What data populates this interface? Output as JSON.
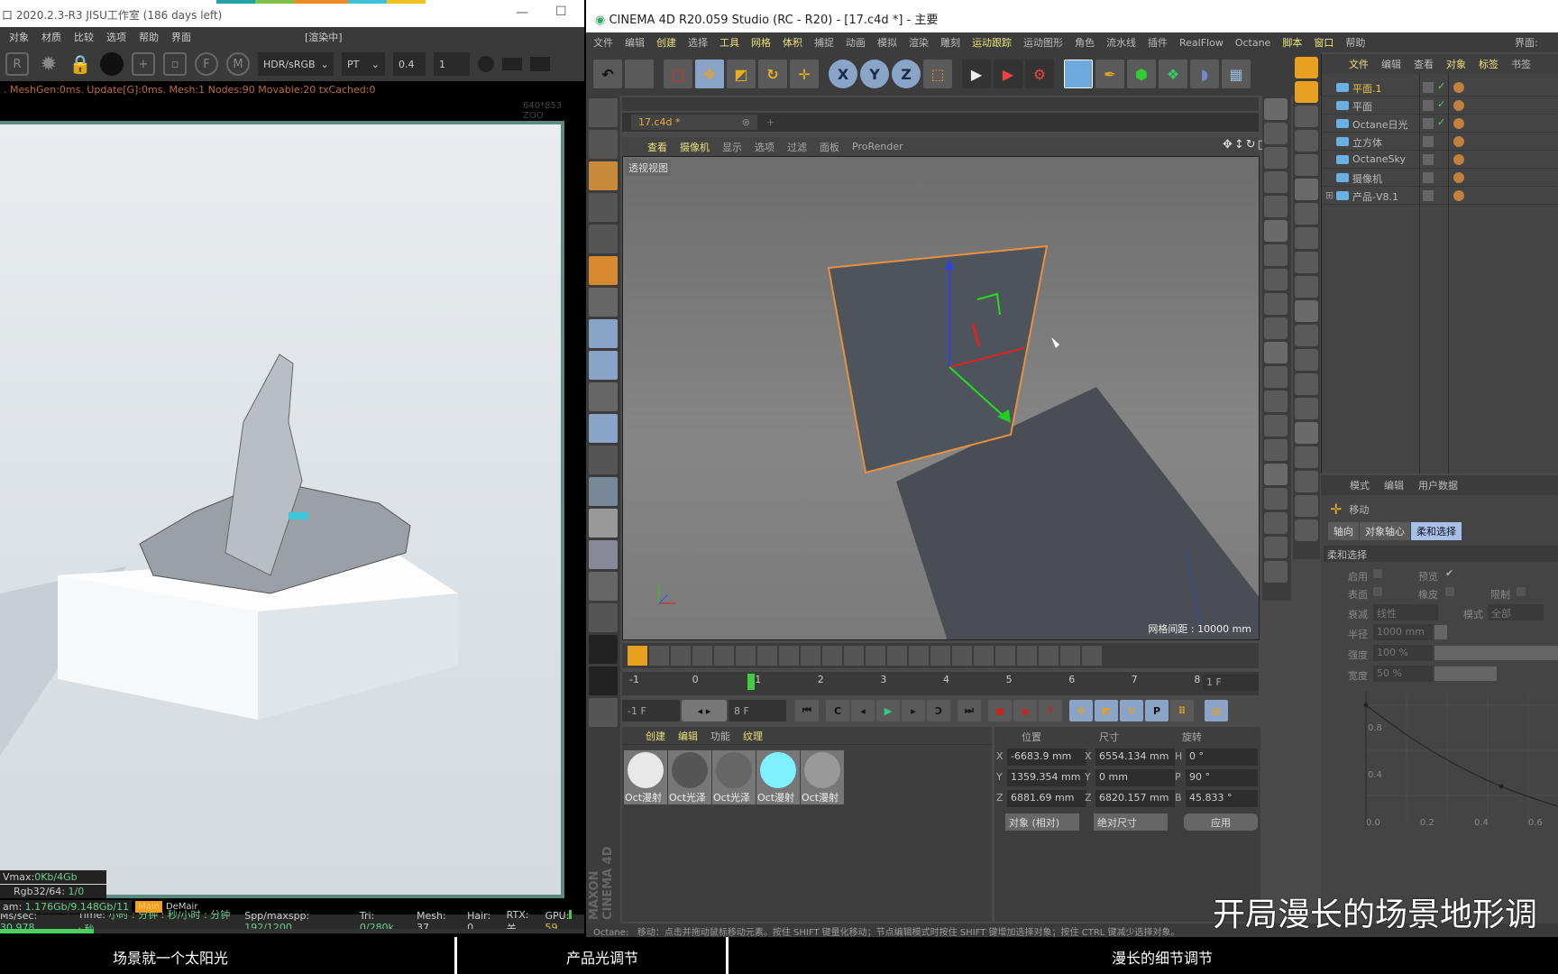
{
  "octane": {
    "title": "口 2020.2.3-R3 JISU工作室 (186 days left)",
    "minimize": "—",
    "maximize": "☐",
    "menu": [
      "对象",
      "材质",
      "比较",
      "选项",
      "帮助",
      "界面"
    ],
    "status": "[渲染中]",
    "toolbar": {
      "buttons": [
        "R",
        "F",
        "M"
      ],
      "colorspace": "HDR/sRGB",
      "kernel": "PT",
      "value1": "0.4",
      "value2": "1"
    },
    "log": ". MeshGen:0ms. Update[G]:0ms. Mesh:1 Nodes:90 Movable:20 txCached:0",
    "resolution": "640*853 ZOO",
    "stats": {
      "vmax_label": "Vmax:",
      "vmax": "0Kb/4Gb",
      "rgb_label": "Rgb32/64:",
      "rgb": "1/0",
      "ram_label": "am:",
      "ram": "1.176Gb/9.148Gb/11",
      "tag1": "Main",
      "tag2": "DeMair",
      "ms_label": "Ms/sec:",
      "ms": "30.978",
      "time_label": "Time:",
      "time": "小时 : 分钟 : 秒/小时 : 分钟 : 秒",
      "spp_label": "Spp/maxspp:",
      "spp": "192/1200",
      "tri_label": "Tri:",
      "tri": "0/280k",
      "mesh": "Mesh: 37",
      "hair": "Hair: 0",
      "rtx": "RTX:关",
      "gpu_label": "GPU:",
      "gpu": "59",
      "progress": 16
    }
  },
  "captions": [
    "场景就一个太阳光",
    "产品光调节",
    "漫长的细节调节"
  ],
  "overlay": "开局漫长的场景地形调",
  "c4d": {
    "title": "CINEMA 4D R20.059 Studio (RC - R20) - [17.c4d *] - 主要",
    "menu": [
      {
        "t": "文件"
      },
      {
        "t": "编辑"
      },
      {
        "t": "创建",
        "hl": true
      },
      {
        "t": "选择"
      },
      {
        "t": "工具",
        "hl": true
      },
      {
        "t": "网格",
        "hl": true
      },
      {
        "t": "体积",
        "hl": true
      },
      {
        "t": "捕捉"
      },
      {
        "t": "动画"
      },
      {
        "t": "模拟"
      },
      {
        "t": "渲染"
      },
      {
        "t": "雕刻"
      },
      {
        "t": "运动跟踪",
        "hl": true
      },
      {
        "t": "运动图形"
      },
      {
        "t": "角色"
      },
      {
        "t": "流水线"
      },
      {
        "t": "插件"
      },
      {
        "t": "RealFlow"
      },
      {
        "t": "Octane"
      },
      {
        "t": "脚本",
        "hl": true
      },
      {
        "t": "窗口",
        "hl": true
      },
      {
        "t": "帮助"
      }
    ],
    "layout_label": "界面:",
    "toolbar_axes": [
      "X",
      "Y",
      "Z"
    ],
    "tab": "17.c4d *",
    "tab_close": "⊗",
    "tab_add": "+",
    "view_menu": [
      {
        "t": "查看",
        "hl": true
      },
      {
        "t": "摄像机",
        "hl": true
      },
      {
        "t": "显示"
      },
      {
        "t": "选项"
      },
      {
        "t": "过滤"
      },
      {
        "t": "面板"
      },
      {
        "t": "ProRender"
      }
    ],
    "view_label": "透视视图",
    "grid": "网格间距 : 10000 mm",
    "om_menu": [
      {
        "t": "文件",
        "hl": true
      },
      {
        "t": "编辑"
      },
      {
        "t": "查看"
      },
      {
        "t": "对象",
        "hl": true
      },
      {
        "t": "标签",
        "hl": true
      },
      {
        "t": "书签"
      }
    ],
    "objects": [
      {
        "name": "平面.1",
        "selected": true,
        "icon": "plane-icon",
        "check": true
      },
      {
        "name": "平面",
        "icon": "plane-icon",
        "check": true
      },
      {
        "name": "Octane日光",
        "icon": "sun-light-icon",
        "check": true
      },
      {
        "name": "立方体",
        "icon": "cube-icon"
      },
      {
        "name": "OctaneSky",
        "icon": "sky-icon"
      },
      {
        "name": "摄像机",
        "icon": "camera-icon"
      },
      {
        "name": "产品-V8.1",
        "icon": "null-icon",
        "expand": "⊞"
      }
    ],
    "am": {
      "menu": [
        "模式",
        "编辑",
        "用户数据"
      ],
      "tool": "移动",
      "tabs": [
        "轴向",
        "对象轴心",
        "柔和选择"
      ],
      "active_tab": 2,
      "section": "柔和选择",
      "enable": "启用",
      "preview": "预览",
      "surface": "表面",
      "rubber": "橡皮",
      "restrict": "限制",
      "falloff_label": "衰减",
      "falloff": "线性",
      "mode_label": "模式",
      "mode": "全部",
      "radius_label": "半径",
      "radius": "1000 mm",
      "radius_fill": 0.1,
      "strength_label": "强度",
      "strength": "100 %",
      "strength_fill": 1.0,
      "width_label": "宽度",
      "width": "50 %",
      "width_fill": 0.5,
      "curve_y_ticks": [
        "0.8",
        "0.4"
      ],
      "curve_x_ticks": [
        "0.0",
        "0.2",
        "0.4",
        "0.6"
      ]
    },
    "timeline": {
      "ticks": [
        "-1",
        "0",
        "1",
        "2",
        "3",
        "4",
        "5",
        "6",
        "7",
        "8"
      ],
      "current": "1",
      "current_frame": "1 F",
      "start": "-1 F",
      "end": "8 F"
    },
    "mat_menu": [
      {
        "t": "创建",
        "hl": true
      },
      {
        "t": "编辑",
        "hl": true
      },
      {
        "t": "功能"
      },
      {
        "t": "纹理",
        "hl": true
      }
    ],
    "materials": [
      {
        "name": "Oct漫射",
        "c": "#e8e8e8"
      },
      {
        "name": "Oct光泽",
        "c": "#555"
      },
      {
        "name": "Oct光泽",
        "c": "#666"
      },
      {
        "name": "Oct漫射",
        "c": "#7ff0ff"
      },
      {
        "name": "Oct漫射",
        "c": "#999"
      }
    ],
    "coords": {
      "pos": "位置",
      "size": "尺寸",
      "rot": "旋转",
      "rows": [
        {
          "a": "X",
          "p": "-6683.9 mm",
          "b": "X",
          "s": "6554.134 mm",
          "c": "H",
          "r": "0 °"
        },
        {
          "a": "Y",
          "p": "1359.354 mm",
          "b": "Y",
          "s": "0 mm",
          "c": "P",
          "r": "90 °"
        },
        {
          "a": "Z",
          "p": "6881.69 mm",
          "b": "Z",
          "s": "6820.157 mm",
          "c": "B",
          "r": "45.833 °"
        }
      ],
      "mode": "对象 (相对)",
      "size_mode": "绝对尺寸",
      "apply": "应用"
    },
    "brand": "MAXON CINEMA 4D",
    "status_label": "Octane:",
    "status": "移动：点击并拖动鼠标移动元素。按住 SHIFT 键量化移动；节点编辑模式时按住 SHIFT 键增加选择对象；按住 CTRL 键减少选择对象。"
  }
}
